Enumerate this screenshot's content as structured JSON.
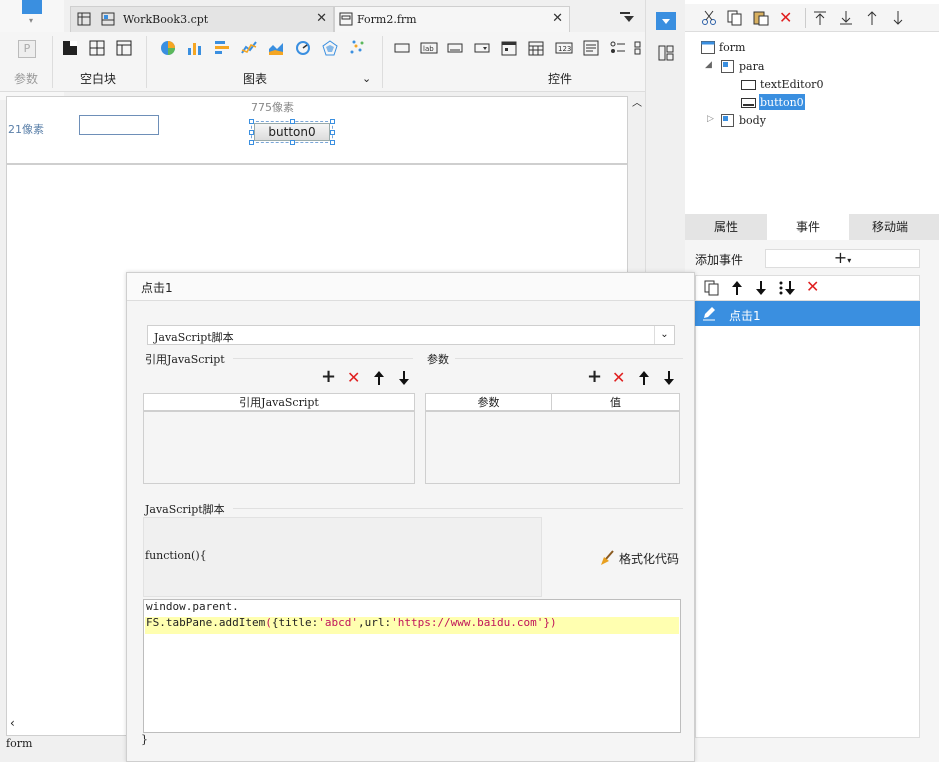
{
  "tabs": [
    {
      "label": "WorkBook3.cpt",
      "active": false
    },
    {
      "label": "Form2.frm",
      "active": true
    }
  ],
  "toolbar": {
    "param_label": "参数",
    "blank_block_label": "空白块",
    "chart_label": "图表",
    "widget_label": "控件"
  },
  "canvas": {
    "width_label": "775像素",
    "height_label": "21像素",
    "button_label": "button0",
    "status_form": "form"
  },
  "tree": {
    "form": "form",
    "para": "para",
    "text_editor": "textEditor0",
    "button": "button0",
    "body": "body"
  },
  "prop_tabs": [
    "属性",
    "事件",
    "移动端"
  ],
  "events": {
    "add_event_label": "添加事件",
    "items": [
      "点击1"
    ]
  },
  "dialog": {
    "title": "点击1",
    "script_type": "JavaScript脚本",
    "ref_js_section": "引用JavaScript",
    "params_section": "参数",
    "ref_js_column": "引用JavaScript",
    "param_columns": [
      "参数",
      "值"
    ],
    "script_section": "JavaScript脚本",
    "function_open": "function(){",
    "format_code_label": "格式化代码",
    "code_line1": "window.parent.",
    "code_line2_prefix": "FS.tabPane.addItem",
    "code_line2_paren_open": "(",
    "code_line2_brace_open": "{title:",
    "code_line2_str1": "'abcd'",
    "code_line2_mid": ",url:",
    "code_line2_str2": "'https://www.baidu.com'",
    "code_line2_close": "})",
    "function_close": "}"
  },
  "colors": {
    "accent": "#3a8fe0",
    "selected_row": "#3a8fe0",
    "code_highlight": "#ffffb0",
    "string_color": "#c0145a",
    "delete_red": "#e02020"
  }
}
